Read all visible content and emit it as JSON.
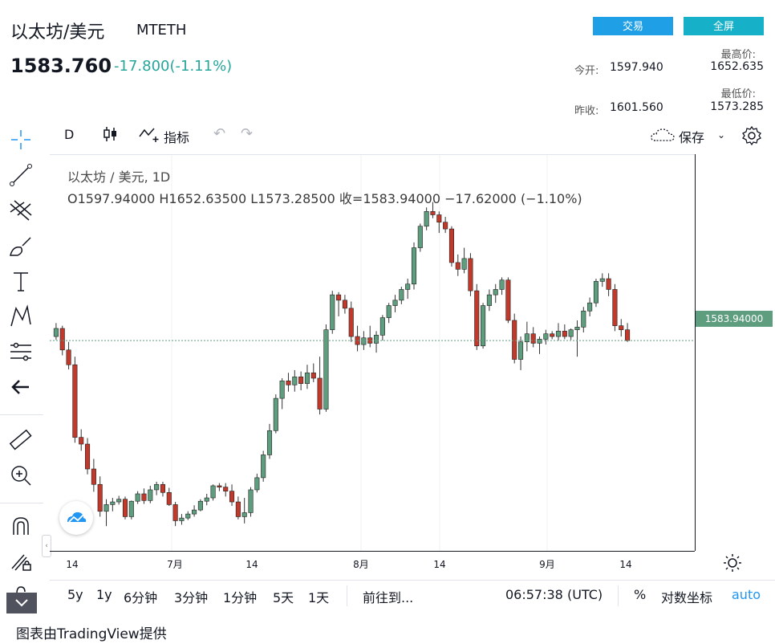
{
  "header": {
    "title": "以太坊/美元",
    "code": "MTETH",
    "price": "1583.760",
    "change": "-17.800(-1.11%)",
    "trade_button": "交易",
    "fullscreen_button": "全屏",
    "high_label": "最高价:",
    "high_value": "1652.635",
    "low_label": "最低价:",
    "low_value": "1573.285",
    "open_label": "今开:",
    "open_value": "1597.940",
    "prev_close_label": "昨收:",
    "prev_close_value": "1601.560"
  },
  "toolbar": {
    "interval": "D",
    "indicators_label": "指标",
    "save_label": "保存"
  },
  "legend": {
    "title": "以太坊 / 美元, 1D",
    "ohlc": "O1597.94000   H1652.63500   L1573.28500   收=1583.94000   −17.62000 (−1.10%)"
  },
  "chart_data": {
    "type": "candlestick",
    "last_price": 1583.94,
    "last_price_label": "1583.94000",
    "colors": {
      "up": "#5e9e7e",
      "down": "#c0392b",
      "axis_text": "#131722"
    },
    "x_ticks": [
      "14",
      "7月",
      "14",
      "8月",
      "14",
      "9月",
      "14"
    ],
    "candles": [
      [
        1590,
        1610,
        1585,
        1602
      ],
      [
        1602,
        1606,
        1562,
        1570
      ],
      [
        1570,
        1582,
        1541,
        1548
      ],
      [
        1548,
        1560,
        1432,
        1440
      ],
      [
        1440,
        1452,
        1420,
        1430
      ],
      [
        1430,
        1439,
        1385,
        1393
      ],
      [
        1393,
        1408,
        1359,
        1370
      ],
      [
        1370,
        1382,
        1322,
        1330
      ],
      [
        1330,
        1348,
        1308,
        1340
      ],
      [
        1340,
        1350,
        1330,
        1344
      ],
      [
        1344,
        1353,
        1340,
        1348
      ],
      [
        1348,
        1352,
        1318,
        1322
      ],
      [
        1322,
        1346,
        1318,
        1345
      ],
      [
        1345,
        1360,
        1341,
        1356
      ],
      [
        1356,
        1364,
        1341,
        1346
      ],
      [
        1346,
        1368,
        1342,
        1362
      ],
      [
        1362,
        1374,
        1354,
        1370
      ],
      [
        1370,
        1374,
        1352,
        1358
      ],
      [
        1358,
        1365,
        1338,
        1340
      ],
      [
        1340,
        1344,
        1308,
        1316
      ],
      [
        1316,
        1326,
        1310,
        1320
      ],
      [
        1320,
        1330,
        1317,
        1326
      ],
      [
        1326,
        1339,
        1322,
        1332
      ],
      [
        1332,
        1348,
        1330,
        1345
      ],
      [
        1345,
        1356,
        1339,
        1350
      ],
      [
        1350,
        1370,
        1346,
        1368
      ],
      [
        1368,
        1372,
        1360,
        1366
      ],
      [
        1366,
        1372,
        1352,
        1360
      ],
      [
        1360,
        1370,
        1338,
        1344
      ],
      [
        1344,
        1352,
        1318,
        1322
      ],
      [
        1322,
        1350,
        1312,
        1328
      ],
      [
        1328,
        1366,
        1322,
        1362
      ],
      [
        1362,
        1386,
        1358,
        1380
      ],
      [
        1380,
        1420,
        1374,
        1414
      ],
      [
        1414,
        1460,
        1408,
        1450
      ],
      [
        1450,
        1504,
        1446,
        1498
      ],
      [
        1498,
        1528,
        1482,
        1524
      ],
      [
        1524,
        1536,
        1508,
        1518
      ],
      [
        1518,
        1540,
        1508,
        1530
      ],
      [
        1530,
        1538,
        1510,
        1520
      ],
      [
        1520,
        1548,
        1512,
        1536
      ],
      [
        1536,
        1550,
        1522,
        1528
      ],
      [
        1528,
        1560,
        1474,
        1482
      ],
      [
        1482,
        1608,
        1478,
        1600
      ],
      [
        1600,
        1658,
        1594,
        1652
      ],
      [
        1652,
        1656,
        1620,
        1644
      ],
      [
        1644,
        1652,
        1624,
        1632
      ],
      [
        1632,
        1642,
        1582,
        1590
      ],
      [
        1590,
        1606,
        1568,
        1578
      ],
      [
        1578,
        1598,
        1570,
        1588
      ],
      [
        1588,
        1606,
        1574,
        1580
      ],
      [
        1580,
        1598,
        1566,
        1592
      ],
      [
        1592,
        1622,
        1584,
        1618
      ],
      [
        1618,
        1640,
        1610,
        1636
      ],
      [
        1636,
        1652,
        1626,
        1644
      ],
      [
        1644,
        1664,
        1638,
        1660
      ],
      [
        1660,
        1676,
        1646,
        1668
      ],
      [
        1668,
        1730,
        1660,
        1722
      ],
      [
        1722,
        1758,
        1716,
        1754
      ],
      [
        1754,
        1782,
        1748,
        1776
      ],
      [
        1776,
        1790,
        1766,
        1771
      ],
      [
        1771,
        1776,
        1744,
        1760
      ],
      [
        1760,
        1768,
        1744,
        1750
      ],
      [
        1750,
        1754,
        1694,
        1700
      ],
      [
        1700,
        1712,
        1680,
        1690
      ],
      [
        1690,
        1722,
        1684,
        1706
      ],
      [
        1706,
        1714,
        1650,
        1658
      ],
      [
        1658,
        1668,
        1570,
        1576
      ],
      [
        1576,
        1640,
        1572,
        1636
      ],
      [
        1636,
        1660,
        1628,
        1652
      ],
      [
        1652,
        1668,
        1640,
        1660
      ],
      [
        1660,
        1678,
        1652,
        1674
      ],
      [
        1674,
        1678,
        1610,
        1614
      ],
      [
        1614,
        1624,
        1550,
        1556
      ],
      [
        1556,
        1590,
        1540,
        1582
      ],
      [
        1582,
        1612,
        1568,
        1594
      ],
      [
        1594,
        1604,
        1574,
        1580
      ],
      [
        1580,
        1590,
        1564,
        1586
      ],
      [
        1586,
        1600,
        1578,
        1594
      ],
      [
        1594,
        1598,
        1586,
        1590
      ],
      [
        1590,
        1610,
        1584,
        1598
      ],
      [
        1598,
        1608,
        1586,
        1590
      ],
      [
        1590,
        1602,
        1585,
        1600
      ],
      [
        1600,
        1614,
        1560,
        1604
      ],
      [
        1604,
        1634,
        1596,
        1628
      ],
      [
        1628,
        1648,
        1620,
        1640
      ],
      [
        1640,
        1676,
        1634,
        1672
      ],
      [
        1672,
        1684,
        1664,
        1676
      ],
      [
        1676,
        1684,
        1650,
        1660
      ],
      [
        1660,
        1668,
        1598,
        1606
      ],
      [
        1606,
        1616,
        1590,
        1600
      ],
      [
        1600,
        1610,
        1582,
        1584
      ]
    ]
  },
  "bottombar": {
    "ranges": [
      "5y",
      "1y",
      "6分钟",
      "3分钟",
      "1分钟",
      "5天",
      "1天"
    ],
    "goto_label": "前往到...",
    "time": "06:57:38 (UTC)",
    "percent_label": "%",
    "log_label": "对数坐标",
    "auto_label": "auto"
  },
  "footer": {
    "text": "图表由TradingView提供"
  }
}
